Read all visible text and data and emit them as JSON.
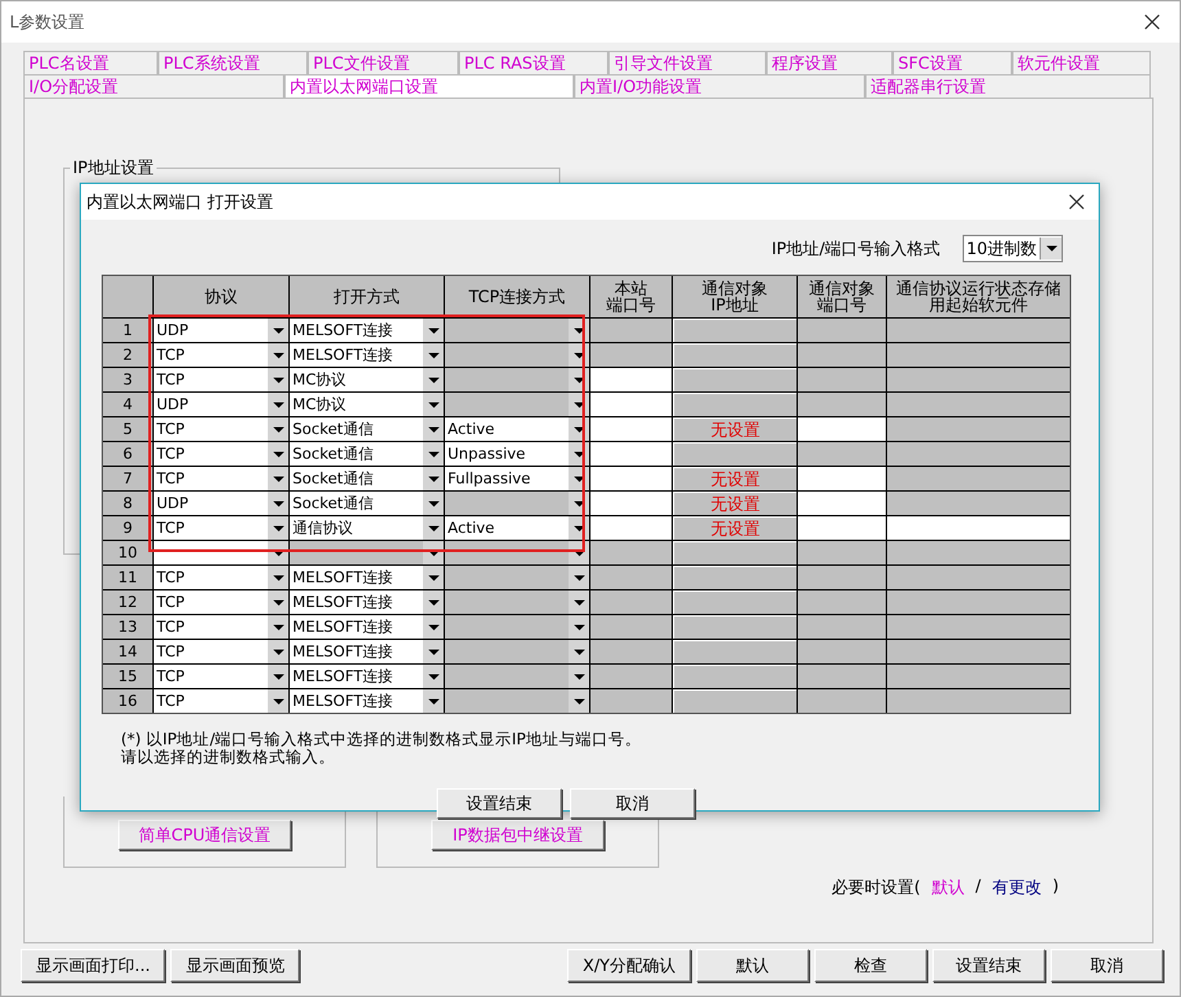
{
  "window": {
    "title": "L参数设置"
  },
  "tab_rows": [
    [
      {
        "label": "PLC名设置",
        "selected": false
      },
      {
        "label": "PLC系统设置",
        "selected": false
      },
      {
        "label": "PLC文件设置",
        "selected": false
      },
      {
        "label": "PLC RAS设置",
        "selected": false
      },
      {
        "label": "引导文件设置",
        "selected": false
      },
      {
        "label": "程序设置",
        "selected": false
      },
      {
        "label": "SFC设置",
        "selected": false
      },
      {
        "label": "软元件设置",
        "selected": false
      }
    ],
    [
      {
        "label": "I/O分配设置",
        "selected": false
      },
      {
        "label": "内置以太网端口设置",
        "selected": true
      },
      {
        "label": "内置I/O功能设置",
        "selected": false
      },
      {
        "label": "适配器串行设置",
        "selected": false
      }
    ]
  ],
  "panel": {
    "ip_group": {
      "legend": "IP地址设置"
    },
    "lower_buttons": [
      "简单CPU通信设置",
      "IP数据包中继设置"
    ],
    "required_note": {
      "prefix": "必要时设置(",
      "default": "默认",
      "separator": "/",
      "changed": "有更改",
      "suffix": ")"
    }
  },
  "dialog": {
    "title": "内置以太网端口 打开设置",
    "format": {
      "label": "IP地址/端口号输入格式",
      "value": "10进制数"
    },
    "table": {
      "columns": [
        {},
        {
          "lines": [
            "协议"
          ]
        },
        {
          "lines": [
            "打开方式"
          ]
        },
        {
          "lines": [
            "TCP连接方式"
          ]
        },
        {
          "lines": [
            "本站",
            "端口号"
          ]
        },
        {
          "lines": [
            "通信对象",
            "IP地址"
          ]
        },
        {
          "lines": [
            "通信对象",
            "端口号"
          ]
        },
        {
          "lines": [
            "通信协议运行状态存储",
            "用起始软元件"
          ]
        }
      ],
      "rows": [
        {
          "no": "1",
          "protocol": "UDP",
          "open_method": "MELSOFT连接",
          "open_enabled": true,
          "tcp_enabled": false,
          "local_port_enabled": false,
          "target_port_enabled": false,
          "device_enabled": false,
          "highlighted": true
        },
        {
          "no": "2",
          "protocol": "TCP",
          "open_method": "MELSOFT连接",
          "open_enabled": true,
          "tcp_enabled": false,
          "local_port_enabled": false,
          "target_port_enabled": false,
          "device_enabled": false,
          "highlighted": true
        },
        {
          "no": "3",
          "protocol": "TCP",
          "open_method": "MC协议",
          "open_enabled": true,
          "tcp_enabled": false,
          "local_port_enabled": true,
          "target_port_enabled": false,
          "device_enabled": false,
          "highlighted": true
        },
        {
          "no": "4",
          "protocol": "UDP",
          "open_method": "MC协议",
          "open_enabled": true,
          "tcp_enabled": false,
          "local_port_enabled": true,
          "target_port_enabled": false,
          "device_enabled": false,
          "highlighted": true
        },
        {
          "no": "5",
          "protocol": "TCP",
          "open_method": "Socket通信",
          "open_enabled": true,
          "tcp_method": "Active",
          "tcp_enabled": true,
          "local_port_enabled": true,
          "target_ip": "无设置",
          "target_port_enabled": true,
          "device_enabled": false,
          "highlighted": true
        },
        {
          "no": "6",
          "protocol": "TCP",
          "open_method": "Socket通信",
          "open_enabled": true,
          "tcp_method": "Unpassive",
          "tcp_enabled": true,
          "local_port_enabled": true,
          "target_port_enabled": false,
          "device_enabled": false,
          "highlighted": true
        },
        {
          "no": "7",
          "protocol": "TCP",
          "open_method": "Socket通信",
          "open_enabled": true,
          "tcp_method": "Fullpassive",
          "tcp_enabled": true,
          "local_port_enabled": true,
          "target_ip": "无设置",
          "target_port_enabled": true,
          "device_enabled": false,
          "highlighted": true
        },
        {
          "no": "8",
          "protocol": "UDP",
          "open_method": "Socket通信",
          "open_enabled": true,
          "tcp_enabled": false,
          "local_port_enabled": true,
          "target_ip": "无设置",
          "target_port_enabled": true,
          "device_enabled": false,
          "highlighted": true
        },
        {
          "no": "9",
          "protocol": "TCP",
          "open_method": "通信协议",
          "open_enabled": true,
          "tcp_method": "Active",
          "tcp_enabled": true,
          "local_port_enabled": true,
          "target_ip": "无设置",
          "target_port_enabled": true,
          "device_enabled": true,
          "highlighted": true
        },
        {
          "no": "10",
          "open_enabled": false,
          "tcp_enabled": false,
          "local_port_enabled": false,
          "target_port_enabled": false,
          "device_enabled": false,
          "highlighted": true
        },
        {
          "no": "11",
          "protocol": "TCP",
          "open_method": "MELSOFT连接",
          "open_enabled": true,
          "tcp_enabled": false,
          "local_port_enabled": false,
          "target_port_enabled": false,
          "device_enabled": false,
          "highlighted": false
        },
        {
          "no": "12",
          "protocol": "TCP",
          "open_method": "MELSOFT连接",
          "open_enabled": true,
          "tcp_enabled": false,
          "local_port_enabled": false,
          "target_port_enabled": false,
          "device_enabled": false,
          "highlighted": false
        },
        {
          "no": "13",
          "protocol": "TCP",
          "open_method": "MELSOFT连接",
          "open_enabled": true,
          "tcp_enabled": false,
          "local_port_enabled": false,
          "target_port_enabled": false,
          "device_enabled": false,
          "highlighted": false
        },
        {
          "no": "14",
          "protocol": "TCP",
          "open_method": "MELSOFT连接",
          "open_enabled": true,
          "tcp_enabled": false,
          "local_port_enabled": false,
          "target_port_enabled": false,
          "device_enabled": false,
          "highlighted": false
        },
        {
          "no": "15",
          "protocol": "TCP",
          "open_method": "MELSOFT连接",
          "open_enabled": true,
          "tcp_enabled": false,
          "local_port_enabled": false,
          "target_port_enabled": false,
          "device_enabled": false,
          "highlighted": false
        },
        {
          "no": "16",
          "protocol": "TCP",
          "open_method": "MELSOFT连接",
          "open_enabled": true,
          "tcp_enabled": false,
          "local_port_enabled": false,
          "target_port_enabled": false,
          "device_enabled": false,
          "highlighted": false
        }
      ]
    },
    "note_lines": [
      "(*) 以IP地址/端口号输入格式中选择的进制数格式显示IP地址与端口号。",
      "请以选择的进制数格式输入。"
    ],
    "buttons": [
      "设置结束",
      "取消"
    ]
  },
  "bottom_buttons_left": [
    "显示画面打印...",
    "显示画面预览"
  ],
  "bottom_buttons_right": [
    "X/Y分配确认",
    "默认",
    "检查",
    "设置结束",
    "取消"
  ]
}
